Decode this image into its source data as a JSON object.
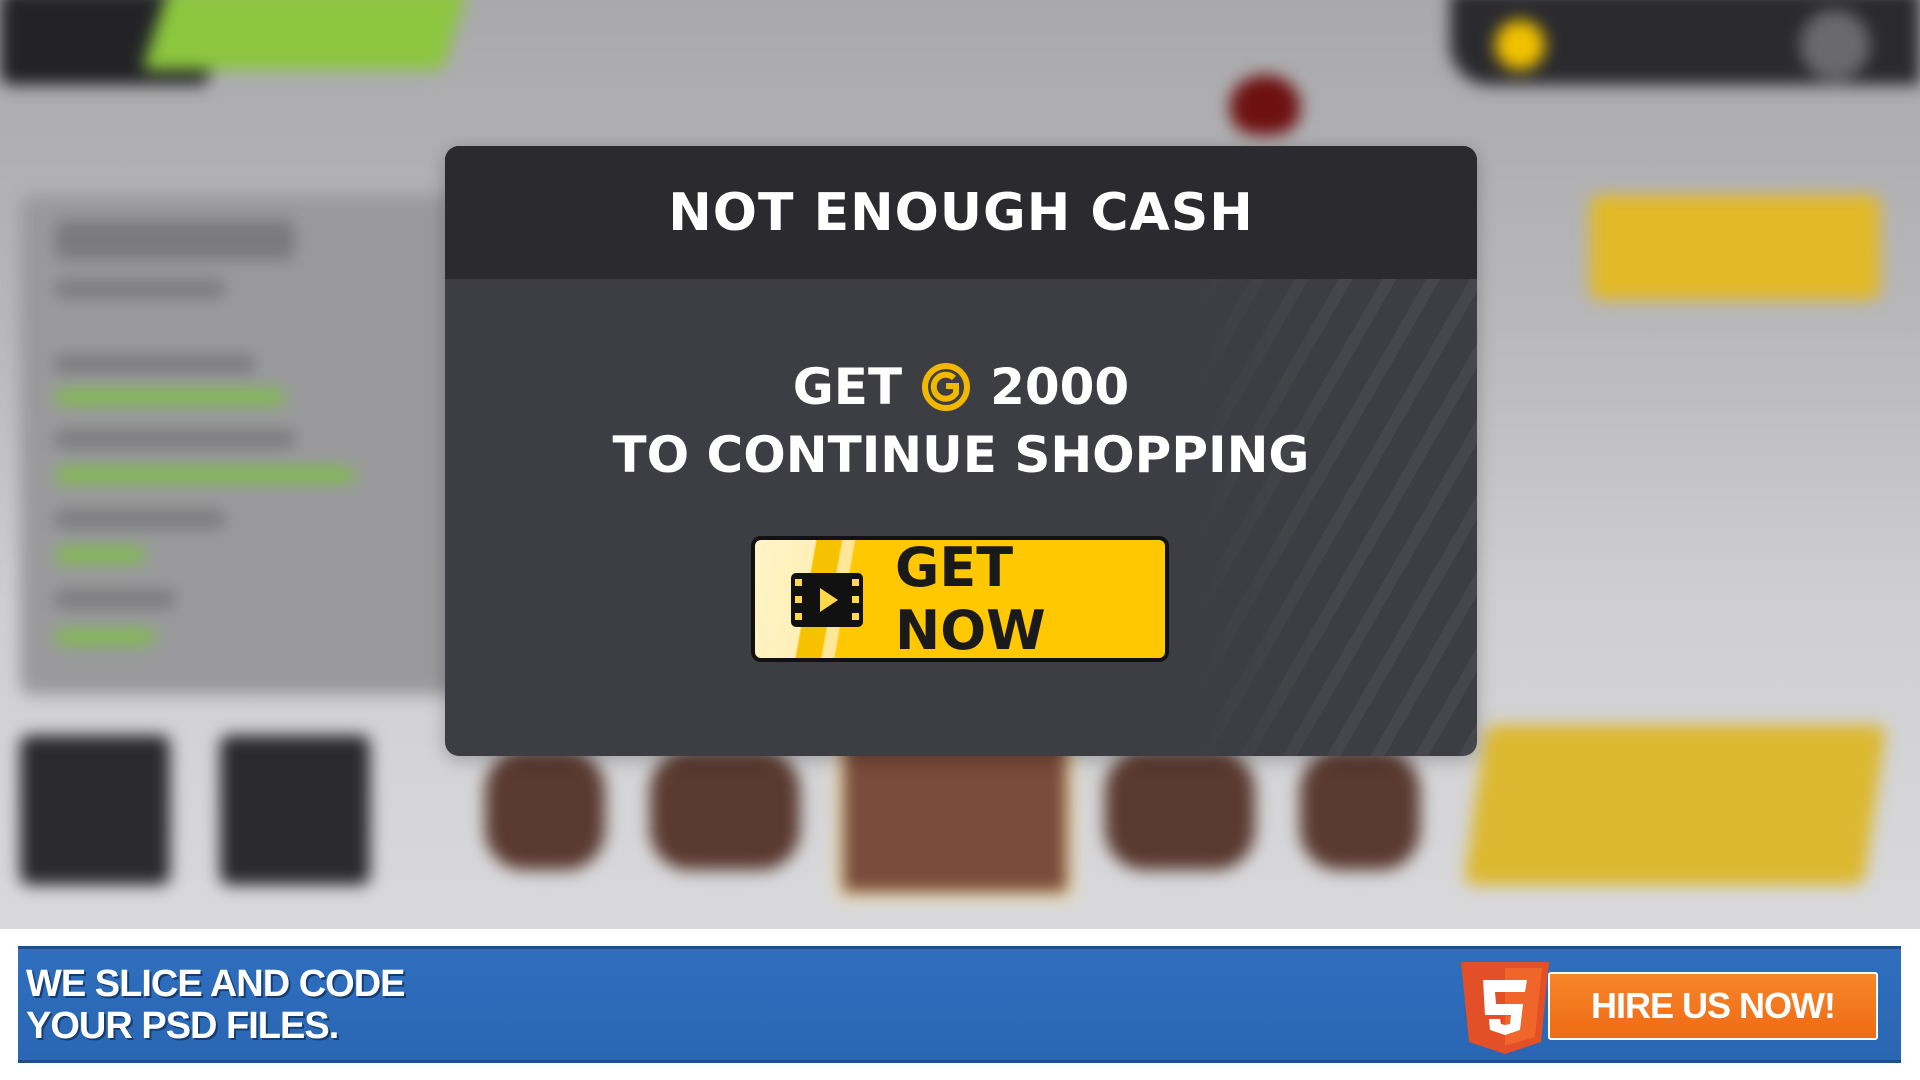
{
  "modal": {
    "title": "NOT ENOUGH CASH",
    "offer_get": "GET",
    "offer_amount": "2000",
    "offer_subtitle": "TO CONTINUE SHOPPING",
    "button_label": "GET NOW",
    "coin_icon": "coin-icon",
    "button_icon": "video-play-icon"
  },
  "ad": {
    "text_line1": "WE SLICE AND CODE",
    "text_line2": "YOUR PSD FILES.",
    "button_label": "HIRE US NOW!",
    "icon": "html5-icon"
  },
  "colors": {
    "modal_bg": "#3d3e43",
    "modal_header": "#2a2a2f",
    "button_yellow": "#ffc800",
    "coin_yellow": "#f2b800",
    "ad_blue": "#2e6fbe",
    "ad_orange": "#ef6a14"
  }
}
